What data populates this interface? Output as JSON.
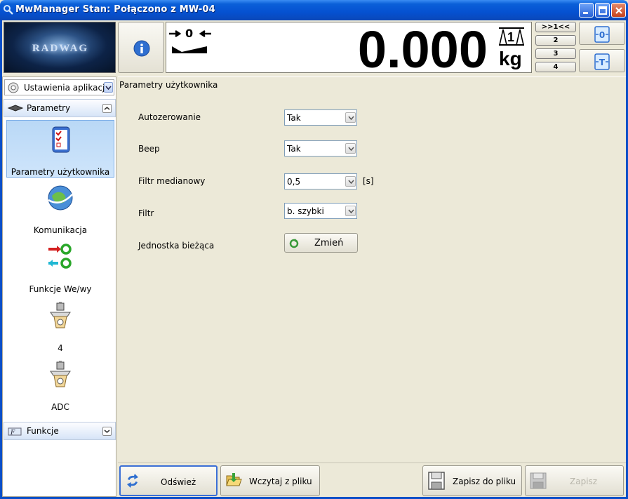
{
  "window": {
    "title": "MwManager   Stan: Połączono z MW-04",
    "app_icon": "search-icon",
    "controls": [
      "minimize-icon",
      "maximize-icon",
      "close-icon"
    ]
  },
  "header": {
    "logo_text": "RADWAG",
    "info_icon": "info-icon",
    "zero_indicator": "0",
    "reading": "0.000",
    "unit": "kg",
    "platform_number": "1",
    "platform_buttons": [
      ">>1<<",
      "2",
      "3",
      "4"
    ],
    "side_buttons": [
      "zero-icon",
      "tare-icon"
    ]
  },
  "sidebar": {
    "settings_combo": "Ustawienia aplikacji",
    "group_params": "Parametry",
    "group_functions": "Funkcje",
    "items": [
      {
        "label": "Parametry użytkownika",
        "icon": "checklist-icon",
        "selected": true
      },
      {
        "label": "Komunikacja",
        "icon": "globe-icon",
        "selected": false
      },
      {
        "label": "Funkcje We/wy",
        "icon": "io-icon",
        "selected": false
      },
      {
        "label": "4",
        "icon": "scale-icon",
        "selected": false
      },
      {
        "label": "ADC",
        "icon": "scale-icon",
        "selected": false
      }
    ]
  },
  "main": {
    "title": "Parametry użytkownika",
    "rows": [
      {
        "label": "Autozerowanie",
        "value": "Tak",
        "unit": ""
      },
      {
        "label": "Beep",
        "value": "Tak",
        "unit": ""
      },
      {
        "label": "Filtr medianowy",
        "value": "0,5",
        "unit": "[s]"
      },
      {
        "label": "Filtr",
        "value": "b. szybki",
        "unit": ""
      },
      {
        "label": "Jednostka bieżąca",
        "button": "Zmień"
      }
    ]
  },
  "footer": {
    "refresh": "Odśwież",
    "load": "Wczytaj z pliku",
    "save_file": "Zapisz do pliku",
    "save": "Zapisz"
  }
}
